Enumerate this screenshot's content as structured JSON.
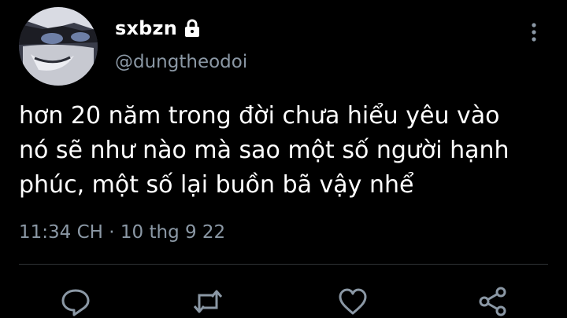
{
  "author": {
    "display_name": "sxbzn",
    "handle": "@dungtheodoi",
    "protected_icon": "lock-icon",
    "avatar_icon": "anime-character-avatar"
  },
  "tweet": {
    "lines": [
      "hơn 20 năm trong đời chưa hiểu yêu vào",
      "nó sẽ như nào mà sao một số người hạnh",
      "phúc, một số lại buồn bã vậy nhể"
    ],
    "time": "11:34 CH",
    "separator": "·",
    "date": "10 thg 9 22"
  },
  "actions": [
    "reply-icon",
    "retweet-icon",
    "like-icon",
    "share-icon"
  ],
  "colors": {
    "background": "#000000",
    "text": "#ffffff",
    "secondary": "#8b98a5",
    "divider": "#2f3336"
  }
}
